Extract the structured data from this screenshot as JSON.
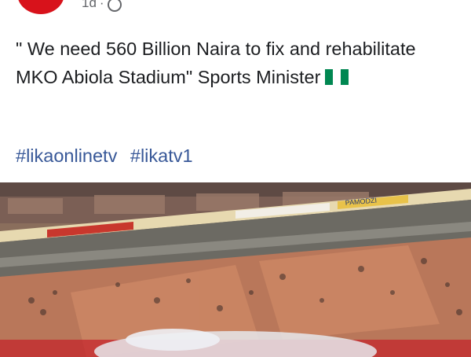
{
  "post": {
    "time": "1d",
    "text": "\" We need 560 Billion Naira to fix and rehabilitate MKO Abiola Stadium\" Sports Minister",
    "hashtags": [
      "#likaonlinetv",
      "#likatv1"
    ]
  },
  "photo": {
    "banner_text": "PAMODZI"
  },
  "colors": {
    "avatar": "#d8121b",
    "link": "#385898",
    "flag_green": "#008751"
  }
}
